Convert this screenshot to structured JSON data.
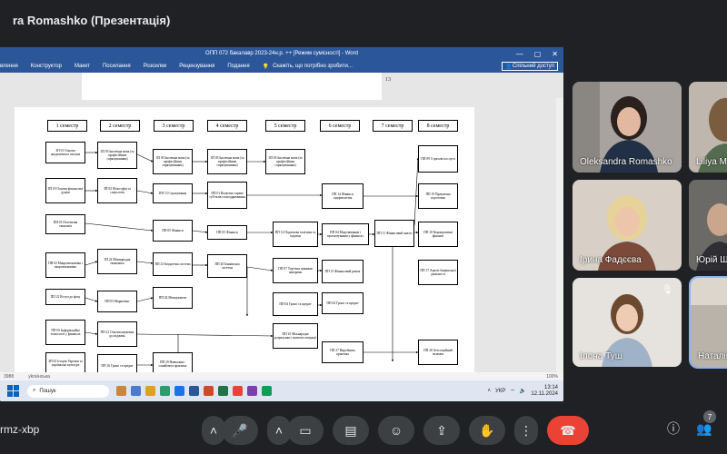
{
  "presenter": {
    "label": "ra Romashko (Презентація)"
  },
  "word": {
    "title": "ОПП 072 бакалавр 2023-24н.р. ++ [Режим сумісності] - Word",
    "ribbon_tabs": [
      "влення",
      "Конструктор",
      "Макет",
      "Посилання",
      "Розсилки",
      "Рецензування",
      "Подання"
    ],
    "tell_me": "Скажіть, що потрібно зробити...",
    "share": "Спільний доступ",
    "page_number": "13",
    "status_left": "ykraїнська",
    "status_words": "3988",
    "zoom": "100%"
  },
  "diagram": {
    "semesters": [
      "1 семестр",
      "2 семестр",
      "3 семестр",
      "4 семестр",
      "5 семестр",
      "6 семестр",
      "7 семестр",
      "8 семестр"
    ],
    "courses": [
      "ЗП 01 Основи академічного письма",
      "ЗП 03 Іноземна мова (за професійним спрямуванням)",
      "ЗП 03 Іноземна мова (за професійним спрямуванням)",
      "ЗП 03 Іноземна мова (за професійним спрямуванням)",
      "ЗП 03 Іноземна мова (за професійним спрямуванням)",
      "ПП 09 Страхові послуги",
      "ЗП 18 Основи фінансової думки",
      "ЗП 04 Філософія та соціологія",
      "ПП 13 Страхування",
      "ПП 01 Валютна справа суб'єктів господарювання",
      "ПП 14 Фінанси підприємства",
      "ПП 19 Практична підготовка",
      "ПН 01 Політична економія",
      "ПП 05 Фінанси",
      "ПП 05 Фінанси",
      "ПП 12 Податкова політика та податки",
      "ПП 04 Моделювання і прогнозування у фінансах",
      "ПП 11 Фінансовий аналіз",
      "ПП 10 Корпоративні фінанси",
      "ПН 02 Макроекономіка і мікроекономіка",
      "ЗП 24 Міжнародна економіка",
      "ПП 23 Бюджетна система",
      "ПП 20 Банківська система",
      "ПП 07 Торгівля цінними паперами",
      "ПП 15 Фінансовий ринок",
      "ПП 17 Аналіз банківської діяльності",
      "ПП 22 Вступ до фаху",
      "ПП 03 Маркетинг",
      "ПП 02 Менеджмент",
      "ПП 04 Гроші та кредит",
      "ПП 04 Гроші та кредит",
      "ПП 05 Інформаційні технології у фінансах",
      "ПП 21 Основи наукових досліджень",
      "ПП 25 Міжнародні розрахунки і валютні операції",
      "ПП 27 Виробнича практика",
      "ПП 28 Атестаційний екзамен",
      "ЗП 02 Історія України та українська культура",
      "ПП 16 Гроші та кредит",
      "ПП 29 Навчально-ознайомча практика"
    ]
  },
  "taskbar": {
    "search_placeholder": "Пошук",
    "language": "УКР",
    "time": "13:14",
    "date": "12.11.2024"
  },
  "participants": [
    {
      "name": "Oleksandra Romashko"
    },
    {
      "name": "Liliya M"
    },
    {
      "name": "Ірина Фадєєва"
    },
    {
      "name": "Юрій Ш"
    },
    {
      "name": "Ілона Туш"
    },
    {
      "name": "Наталія"
    }
  ],
  "meeting": {
    "code": "rmz-xbp",
    "participants_count": "7"
  },
  "colors": {
    "background": "#202124",
    "word_blue": "#2b579a",
    "end_call": "#ea4335",
    "active_outline": "#8ab4f8"
  }
}
